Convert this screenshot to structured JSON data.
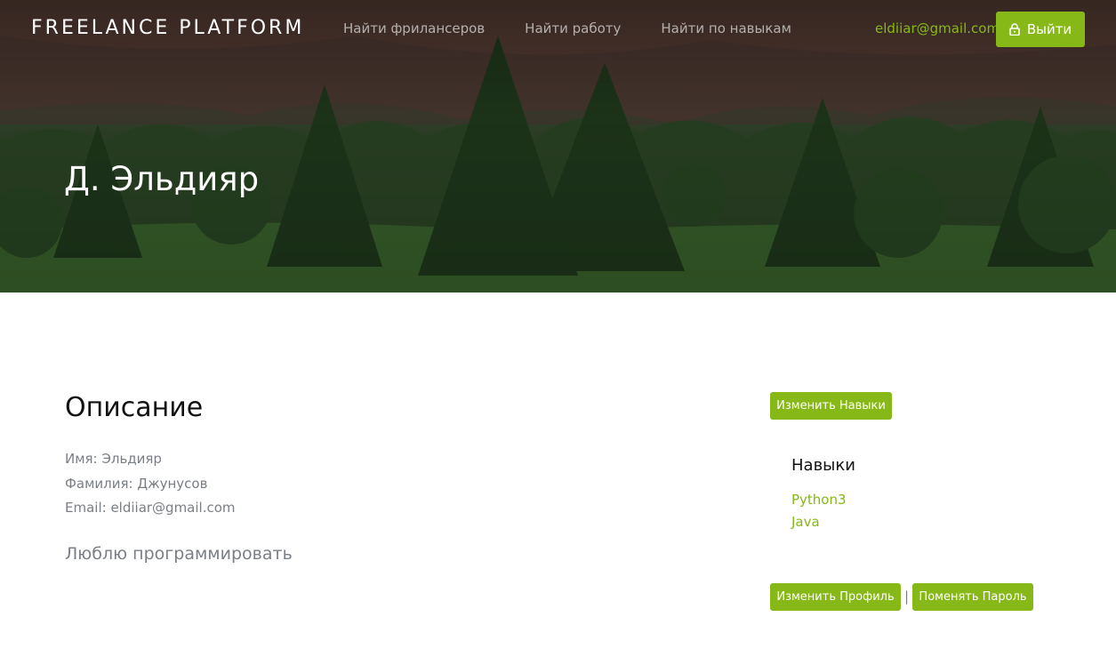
{
  "navbar": {
    "brand": "FREELANCE PLATFORM",
    "links": [
      "Найти фрилансеров",
      "Найти работу",
      "Найти по навыкам"
    ],
    "user_email": "eldiiar@gmail.com",
    "logout_label": "Выйти",
    "logout_icon": "lock-icon"
  },
  "hero": {
    "title": "Д. Эльдияр"
  },
  "description": {
    "title": "Описание",
    "first_name": "Имя: Эльдияр",
    "last_name": "Фамилия: Джунусов",
    "email": "Email: eldiiar@gmail.com",
    "about": "Люблю программировать"
  },
  "skills": {
    "edit_label": "Изменить Навыки",
    "title": "Навыки",
    "items": [
      "Python3",
      "Java"
    ]
  },
  "actions": {
    "edit_profile_label": "Изменить Профиль",
    "separator": "|",
    "change_password_label": "Поменять Пароль"
  },
  "colors": {
    "accent": "#86b817",
    "muted_text": "#7a7f86",
    "heading_text": "#111111"
  }
}
